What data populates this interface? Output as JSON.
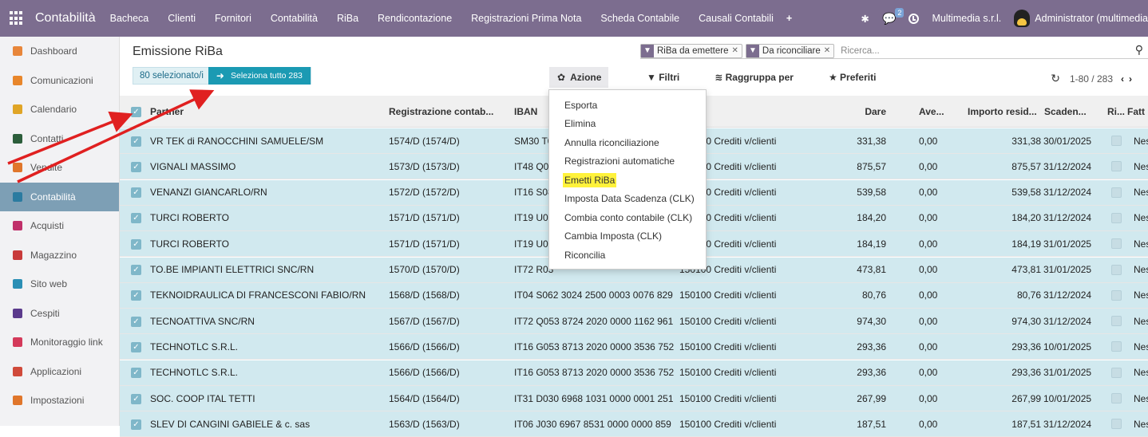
{
  "topbar": {
    "app_name": "Contabilità",
    "menu": [
      "Bacheca",
      "Clienti",
      "Fornitori",
      "Contabilità",
      "RiBa",
      "Rendicontazione",
      "Registrazioni Prima Nota",
      "Scheda Contabile",
      "Causali Contabili"
    ],
    "plus": "+",
    "chat_count": "2",
    "company": "Multimedia s.r.l.",
    "user": "Administrator (multimedia"
  },
  "sidebar": {
    "items": [
      {
        "label": "Dashboard",
        "color": "#e8863a"
      },
      {
        "label": "Comunicazioni",
        "color": "#e8862b"
      },
      {
        "label": "Calendario",
        "color": "#e0a526"
      },
      {
        "label": "Contatti",
        "color": "#2c5e3b"
      },
      {
        "label": "Vendite",
        "color": "#e0762b"
      },
      {
        "label": "Contabilità",
        "color": "#2b7ba0"
      },
      {
        "label": "Acquisti",
        "color": "#c0306a"
      },
      {
        "label": "Magazzino",
        "color": "#c83a3a"
      },
      {
        "label": "Sito web",
        "color": "#2b8fb5"
      },
      {
        "label": "Cespiti",
        "color": "#5b3a8c"
      },
      {
        "label": "Monitoraggio link",
        "color": "#d43a5a"
      },
      {
        "label": "Applicazioni",
        "color": "#d04a3a"
      },
      {
        "label": "Impostazioni",
        "color": "#e0762b"
      }
    ]
  },
  "page": {
    "title": "Emissione RiBa",
    "filters": [
      "RiBa da emettere",
      "Da riconciliare"
    ],
    "search_placeholder": "Ricerca...",
    "selected_count": "80 selezionato/i",
    "select_all": "Seleziona tutto 283",
    "action_label": "Azione",
    "filters_label": "Filtri",
    "groupby_label": "Raggruppa per",
    "favorites_label": "Preferiti",
    "pager": "1-80 / 283"
  },
  "columns": [
    "Partner",
    "Registrazione contab...",
    "IBAN",
    "",
    "Dare",
    "Ave...",
    "Importo resid...",
    "Scaden...",
    "Ri...",
    "Fatt"
  ],
  "rows": [
    {
      "partner": "VR TEK di RANOCCHINI SAMUELE/SM",
      "reg": "1574/D (1574/D)",
      "iban": "SM30 T0",
      "account": "150100 Crediti v/clienti",
      "dare": "331,38",
      "avere": "0,00",
      "residuo": "331,38",
      "scadenza": "30/01/2025",
      "fatt": "Nes"
    },
    {
      "partner": "VIGNALI MASSIMO",
      "reg": "1573/D (1573/D)",
      "iban": "IT48 Q0",
      "account": "150100 Crediti v/clienti",
      "dare": "875,57",
      "avere": "0,00",
      "residuo": "875,57",
      "scadenza": "31/12/2024",
      "fatt": "Nes"
    },
    {
      "partner": "VENANZI GIANCARLO/RN",
      "reg": "1572/D (1572/D)",
      "iban": "IT16 S08",
      "account": "150100 Crediti v/clienti",
      "dare": "539,58",
      "avere": "0,00",
      "residuo": "539,58",
      "scadenza": "31/12/2024",
      "fatt": "Nes"
    },
    {
      "partner": "TURCI ROBERTO",
      "reg": "1571/D (1571/D)",
      "iban": "IT19 U08",
      "account": "150100 Crediti v/clienti",
      "dare": "184,20",
      "avere": "0,00",
      "residuo": "184,20",
      "scadenza": "31/12/2024",
      "fatt": "Nes"
    },
    {
      "partner": "TURCI ROBERTO",
      "reg": "1571/D (1571/D)",
      "iban": "IT19 U08",
      "account": "150100 Crediti v/clienti",
      "dare": "184,19",
      "avere": "0,00",
      "residuo": "184,19",
      "scadenza": "31/01/2025",
      "fatt": "Nes"
    },
    {
      "partner": "TO.BE IMPIANTI ELETTRICI SNC/RN",
      "reg": "1570/D (1570/D)",
      "iban": "IT72 R03",
      "account": "150100 Crediti v/clienti",
      "dare": "473,81",
      "avere": "0,00",
      "residuo": "473,81",
      "scadenza": "31/01/2025",
      "fatt": "Nes"
    },
    {
      "partner": "TEKNOIDRAULICA DI FRANCESCONI FABIO/RN",
      "reg": "1568/D (1568/D)",
      "iban": "IT04 S062 3024 2500 0003 0076 829",
      "account": "150100 Crediti v/clienti",
      "dare": "80,76",
      "avere": "0,00",
      "residuo": "80,76",
      "scadenza": "31/12/2024",
      "fatt": "Nes"
    },
    {
      "partner": "TECNOATTIVA SNC/RN",
      "reg": "1567/D (1567/D)",
      "iban": "IT72 Q053 8724 2020 0000 1162 961",
      "account": "150100 Crediti v/clienti",
      "dare": "974,30",
      "avere": "0,00",
      "residuo": "974,30",
      "scadenza": "31/12/2024",
      "fatt": "Nes"
    },
    {
      "partner": "TECHNOTLC S.R.L.",
      "reg": "1566/D (1566/D)",
      "iban": "IT16 G053 8713 2020 0000 3536 752",
      "account": "150100 Crediti v/clienti",
      "dare": "293,36",
      "avere": "0,00",
      "residuo": "293,36",
      "scadenza": "10/01/2025",
      "fatt": "Nes"
    },
    {
      "partner": "TECHNOTLC S.R.L.",
      "reg": "1566/D (1566/D)",
      "iban": "IT16 G053 8713 2020 0000 3536 752",
      "account": "150100 Crediti v/clienti",
      "dare": "293,36",
      "avere": "0,00",
      "residuo": "293,36",
      "scadenza": "31/01/2025",
      "fatt": "Nes"
    },
    {
      "partner": "SOC. COOP ITAL TETTI",
      "reg": "1564/D (1564/D)",
      "iban": "IT31 D030 6968 1031 0000 0001 251",
      "account": "150100 Crediti v/clienti",
      "dare": "267,99",
      "avere": "0,00",
      "residuo": "267,99",
      "scadenza": "10/01/2025",
      "fatt": "Nes"
    },
    {
      "partner": "SLEV DI CANGINI GABIELE & c. sas",
      "reg": "1563/D (1563/D)",
      "iban": "IT06 J030 6967 8531 0000 0000 859",
      "account": "150100 Crediti v/clienti",
      "dare": "187,51",
      "avere": "0,00",
      "residuo": "187,51",
      "scadenza": "31/12/2024",
      "fatt": "Nes"
    }
  ],
  "action_menu": [
    "Esporta",
    "Elimina",
    "Annulla riconciliazione",
    "Registrazioni automatiche",
    "Emetti RiBa",
    "Imposta Data Scadenza (CLK)",
    "Combia conto contabile (CLK)",
    "Cambia Imposta (CLK)",
    "Riconcilia"
  ],
  "highlighted_action": "Emetti RiBa",
  "colors": {
    "topbar": "#7c6d8f",
    "row_selected": "#d1e9ef",
    "select_all_button": "#1b9ab3",
    "highlight": "#fff23b",
    "annotation_arrow": "#e02020"
  }
}
